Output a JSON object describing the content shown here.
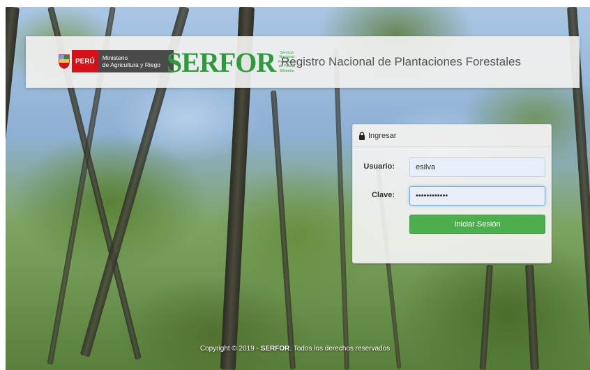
{
  "header": {
    "gov_country": "PERÚ",
    "gov_ministry_line1": "Ministerio",
    "gov_ministry_line2": "de Agricultura y Riego",
    "brand_name": "SERFOR",
    "brand_subtitle": "Servicio Nacional Forestal y de Fauna Silvestre",
    "title": "Registro Nacional de Plantaciones Forestales"
  },
  "login": {
    "heading": "Ingresar",
    "username_label": "Usuario:",
    "username_value": "esilva",
    "password_label": "Clave:",
    "password_value": "••••••••••••",
    "submit_label": "Iniciar Sesión"
  },
  "footer": {
    "copyright_prefix": "Copyright © 2019 - ",
    "org": "SERFOR",
    "copyright_suffix": ". Todos los derechos reservados"
  },
  "colors": {
    "accent_green": "#4cae4c",
    "brand_green": "#2f9a3c",
    "peru_red": "#d6111a"
  }
}
